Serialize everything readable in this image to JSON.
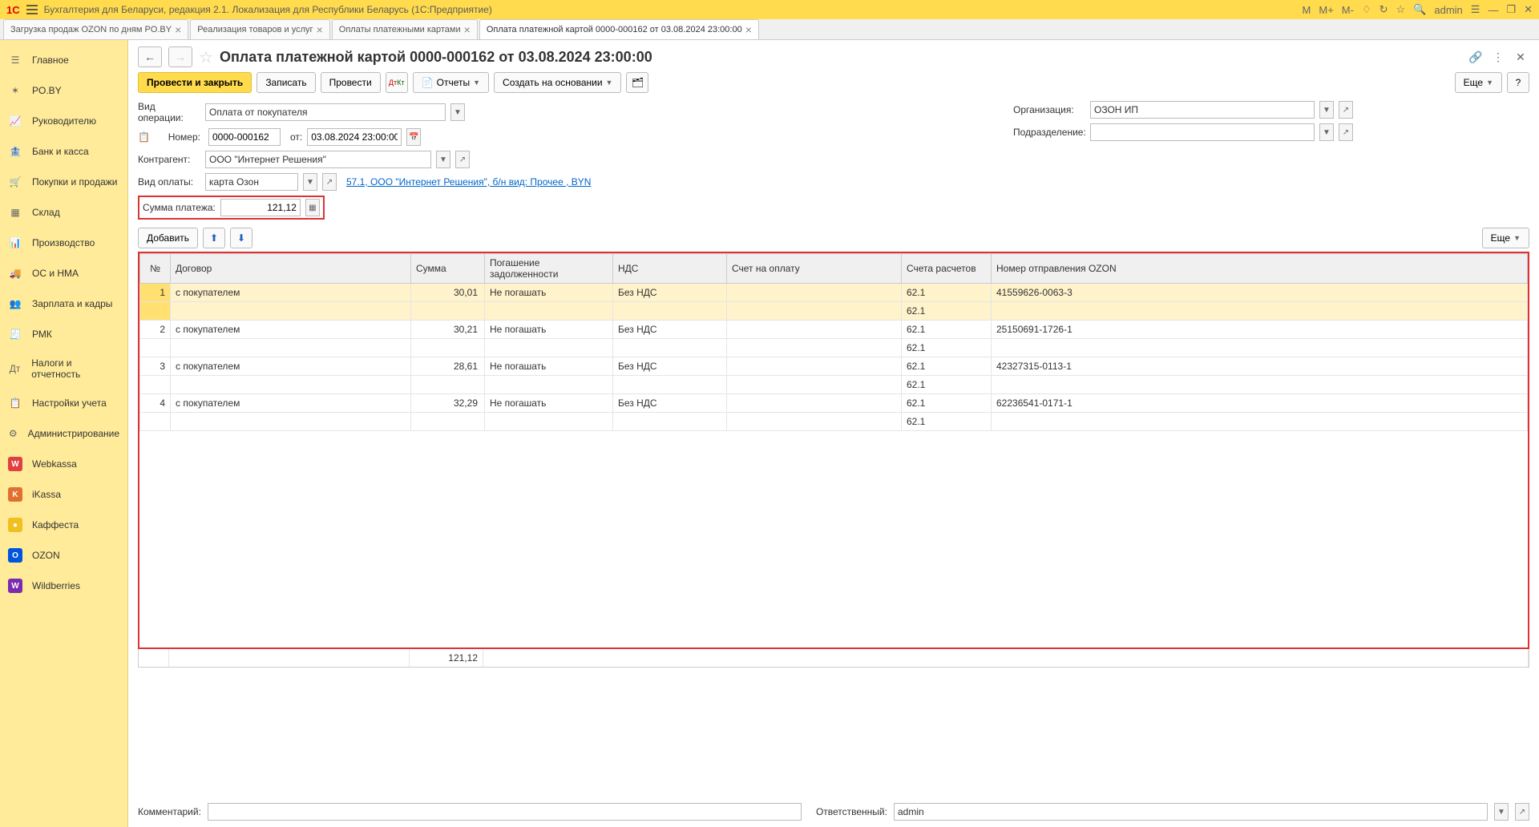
{
  "title": "Бухгалтерия для Беларуси, редакция 2.1. Локализация для Республики Беларусь  (1С:Предприятие)",
  "titlebar_buttons": {
    "m": "M",
    "mplus": "M+",
    "mminus": "M-",
    "user": "admin"
  },
  "tabs": [
    {
      "label": "Загрузка продаж OZON по дням PO.BY",
      "active": false
    },
    {
      "label": "Реализация товаров и услуг",
      "active": false
    },
    {
      "label": "Оплаты платежными картами",
      "active": false
    },
    {
      "label": "Оплата платежной картой 0000-000162 от 03.08.2024 23:00:00",
      "active": true
    }
  ],
  "sidebar": [
    {
      "label": "Главное",
      "icon": "home"
    },
    {
      "label": "PO.BY",
      "icon": "star"
    },
    {
      "label": "Руководителю",
      "icon": "chart"
    },
    {
      "label": "Банк и касса",
      "icon": "bank"
    },
    {
      "label": "Покупки и продажи",
      "icon": "cart"
    },
    {
      "label": "Склад",
      "icon": "boxes"
    },
    {
      "label": "Производство",
      "icon": "chart2"
    },
    {
      "label": "ОС и НМА",
      "icon": "truck"
    },
    {
      "label": "Зарплата и кадры",
      "icon": "people"
    },
    {
      "label": "РМК",
      "icon": "cash"
    },
    {
      "label": "Налоги и отчетность",
      "icon": "tax"
    },
    {
      "label": "Настройки учета",
      "icon": "clipboard"
    },
    {
      "label": "Администрирование",
      "icon": "gear"
    },
    {
      "label": "Webkassa",
      "icon": "wk",
      "color": "#e04040"
    },
    {
      "label": "iKassa",
      "icon": "ik",
      "color": "#e07030"
    },
    {
      "label": "Каффеста",
      "icon": "kf",
      "color": "#f0c020"
    },
    {
      "label": "OZON",
      "icon": "oz",
      "color": "#0055dd"
    },
    {
      "label": "Wildberries",
      "icon": "wb",
      "color": "#7b2bb0"
    }
  ],
  "doc_title": "Оплата платежной картой 0000-000162 от 03.08.2024 23:00:00",
  "toolbar": {
    "post_close": "Провести и закрыть",
    "write": "Записать",
    "post": "Провести",
    "reports": "Отчеты",
    "create_based": "Создать на основании",
    "more": "Еще",
    "help": "?"
  },
  "form": {
    "operation_label": "Вид операции:",
    "operation_value": "Оплата от покупателя",
    "number_label": "Номер:",
    "number_value": "0000-000162",
    "from_label": "от:",
    "date_value": "03.08.2024 23:00:00",
    "counterparty_label": "Контрагент:",
    "counterparty_value": "ООО \"Интернет Решения\"",
    "payment_type_label": "Вид оплаты:",
    "payment_type_value": "карта Озон",
    "payment_link": "57.1, ООО \"Интернет Решения\",  б/н вид: Прочее , BYN",
    "org_label": "Организация:",
    "org_value": "ОЗОН ИП",
    "dept_label": "Подразделение:",
    "dept_value": "",
    "sum_label": "Сумма платежа:",
    "sum_value": "121,12"
  },
  "table_toolbar": {
    "add": "Добавить",
    "more": "Еще"
  },
  "table": {
    "headers": [
      "№",
      "Договор",
      "Сумма",
      "Погашение задолженности",
      "НДС",
      "Счет на оплату",
      "Счета расчетов",
      "Номер отправления OZON"
    ],
    "rows": [
      {
        "n": "1",
        "contract": "с покупателем",
        "sum": "30,01",
        "repay": "Не погашать",
        "vat": "Без НДС",
        "invoice": "",
        "acc1": "62.1",
        "acc2": "62.1",
        "ozon": "41559626-0063-3",
        "selected": true
      },
      {
        "n": "2",
        "contract": "с покупателем",
        "sum": "30,21",
        "repay": "Не погашать",
        "vat": "Без НДС",
        "invoice": "",
        "acc1": "62.1",
        "acc2": "62.1",
        "ozon": "25150691-1726-1",
        "selected": false
      },
      {
        "n": "3",
        "contract": "с покупателем",
        "sum": "28,61",
        "repay": "Не погашать",
        "vat": "Без НДС",
        "invoice": "",
        "acc1": "62.1",
        "acc2": "62.1",
        "ozon": "42327315-0113-1",
        "selected": false
      },
      {
        "n": "4",
        "contract": "с покупателем",
        "sum": "32,29",
        "repay": "Не погашать",
        "vat": "Без НДС",
        "invoice": "",
        "acc1": "62.1",
        "acc2": "62.1",
        "ozon": "62236541-0171-1",
        "selected": false
      }
    ],
    "footer_sum": "121,12"
  },
  "bottom": {
    "comment_label": "Комментарий:",
    "comment_value": "",
    "responsible_label": "Ответственный:",
    "responsible_value": "admin"
  }
}
